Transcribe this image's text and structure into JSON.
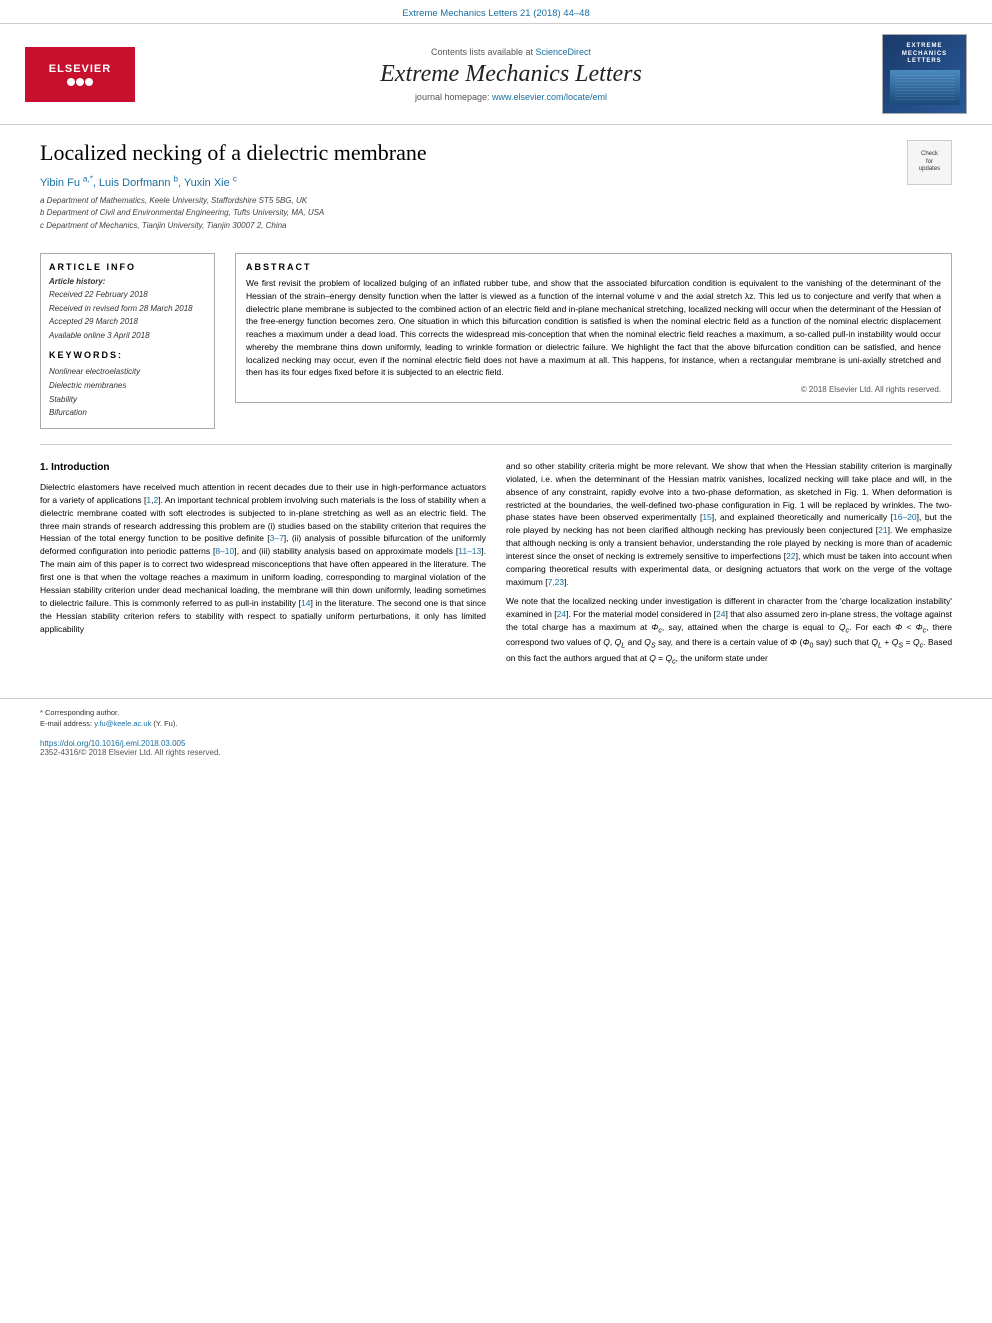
{
  "journal": {
    "link_bar": "Extreme Mechanics Letters 21 (2018) 44–48",
    "contents_text": "Contents lists available at ",
    "contents_link": "ScienceDirect",
    "title": "Extreme Mechanics Letters",
    "homepage_text": "journal homepage: ",
    "homepage_link": "www.elsevier.com/locate/eml",
    "elsevier_logo": "ELSEVIER",
    "cover_title": "EXTREME\nMECHANICS\nLETTERS"
  },
  "article": {
    "title": "Localized necking of a dielectric membrane",
    "authors": "Yibin Fu",
    "authors_full": "Yibin Fu a,*, Luis Dorfmann b, Yuxin Xie c",
    "author_a_sup": "a",
    "author_b_sup": "b",
    "author_c_sup": "c",
    "affil_a": "a Department of Mathematics, Keele University, Staffordshire ST5 5BG, UK",
    "affil_b": "b Department of Civil and Environmental Engineering, Tufts University, MA, USA",
    "affil_c": "c Department of Mechanics, Tianjin University, Tianjin 30007 2, China",
    "check_updates": "Check for\nupdates"
  },
  "article_info": {
    "header": "ARTICLE INFO",
    "history_label": "Article history:",
    "received": "Received 22 February 2018",
    "received_revised": "Received in revised form 28 March 2018",
    "accepted": "Accepted 29 March 2018",
    "available": "Available online 3 April 2018",
    "keywords_label": "Keywords:",
    "kw1": "Nonlinear electroelasticity",
    "kw2": "Dielectric membranes",
    "kw3": "Stability",
    "kw4": "Bifurcation"
  },
  "abstract": {
    "header": "ABSTRACT",
    "text": "We first revisit the problem of localized bulging of an inflated rubber tube, and show that the associated bifurcation condition is equivalent to the vanishing of the determinant of the Hessian of the strain–energy density function when the latter is viewed as a function of the internal volume v and the axial stretch λz. This led us to conjecture and verify that when a dielectric plane membrane is subjected to the combined action of an electric field and in-plane mechanical stretching, localized necking will occur when the determinant of the Hessian of the free-energy function becomes zero. One situation in which this bifurcation condition is satisfied is when the nominal electric field as a function of the nominal electric displacement reaches a maximum under a dead load. This corrects the widespread mis-conception that when the nominal electric field reaches a maximum, a so-called pull-in instability would occur whereby the membrane thins down uniformly, leading to wrinkle formation or dielectric failure. We highlight the fact that the above bifurcation condition can be satisfied, and hence localized necking may occur, even if the nominal electric field does not have a maximum at all. This happens, for instance, when a rectangular membrane is uni-axially stretched and then has its four edges fixed before it is subjected to an electric field.",
    "copyright": "© 2018 Elsevier Ltd. All rights reserved."
  },
  "intro": {
    "heading": "1. Introduction",
    "para1": "Dielectric elastomers have received much attention in recent decades due to their use in high-performance actuators for a variety of applications [1,2]. An important technical problem involving such materials is the loss of stability when a dielectric membrane coated with soft electrodes is subjected to in-plane stretching as well as an electric field. The three main strands of research addressing this problem are (i) studies based on the stability criterion that requires the Hessian of the total energy function to be positive definite [3–7], (ii) analysis of possible bifurcation of the uniformly deformed configuration into periodic patterns [8–10], and (iii) stability analysis based on approximate models [11–13]. The main aim of this paper is to correct two widespread misconceptions that have often appeared in the literature. The first one is that when the voltage reaches a maximum in uniform loading, corresponding to marginal violation of the Hessian stability criterion under dead mechanical loading, the membrane will thin down uniformly, leading sometimes to dielectric failure. This is commonly referred to as pull-in instability [14] in the literature. The second one is that since the Hessian stability criterion refers to stability with respect to spatially uniform perturbations, it only has limited applicability",
    "para2": "and so other stability criteria might be more relevant. We show that when the Hessian stability criterion is marginally violated, i.e. when the determinant of the Hessian matrix vanishes, localized necking will take place and will, in the absence of any constraint, rapidly evolve into a two-phase deformation, as sketched in Fig. 1. When deformation is restricted at the boundaries, the well-defined two-phase configuration in Fig. 1 will be replaced by wrinkles. The two-phase states have been observed experimentally [15], and explained theoretically and numerically [16–20], but the role played by necking has not been clarified although necking has previously been conjectured [21]. We emphasize that although necking is only a transient behavior, understanding the role played by necking is more than of academic interest since the onset of necking is extremely sensitive to imperfections [22], which must be taken into account when comparing theoretical results with experimental data, or designing actuators that work on the verge of the voltage maximum [7,23].",
    "para3": "We note that the localized necking under investigation is different in character from the 'charge localization instability' examined in [24]. For the material model considered in [24] that also assumed zero in-plane stress, the voltage against the total charge has a maximum at Φc, say, attained when the charge is equal to Qc. For each Φ < Φc, there correspond two values of Q, QL and QS say, and there is a certain value of Φ (Φ0 say) such that QL + QS = Qc. Based on this fact the authors argued that at Q = Qc, the uniform state under"
  },
  "footer": {
    "note_star": "* Corresponding author.",
    "email_label": "E-mail address: ",
    "email": "y.fu@keele.ac.uk",
    "email_person": " (Y. Fu).",
    "doi": "https://doi.org/10.1016/j.eml.2018.03.005",
    "issn": "2352-4316/© 2018 Elsevier Ltd. All rights reserved."
  }
}
